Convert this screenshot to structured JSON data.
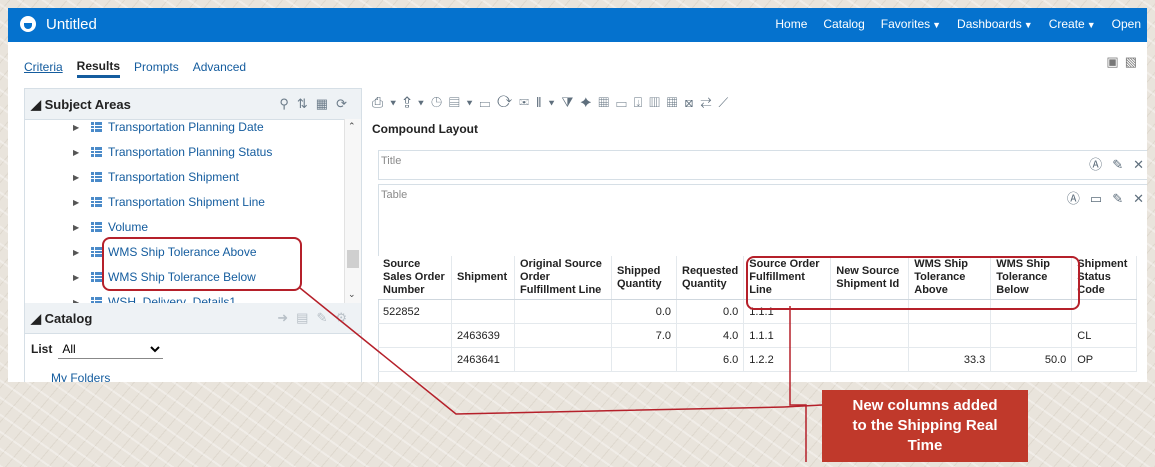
{
  "app": {
    "title": "Untitled"
  },
  "topnav": {
    "home": "Home",
    "catalog": "Catalog",
    "favorites": "Favorites",
    "dashboards": "Dashboards",
    "create": "Create",
    "open": "Open"
  },
  "subtabs": {
    "criteria": "Criteria",
    "results": "Results",
    "prompts": "Prompts",
    "advanced": "Advanced"
  },
  "subject_areas": {
    "title": "Subject Areas",
    "items": [
      "Transportation Planning Date",
      "Transportation Planning Status",
      "Transportation Shipment",
      "Transportation Shipment Line",
      "Volume",
      "WMS Ship Tolerance Above",
      "WMS Ship Tolerance Below",
      "WSH_Delivery_Details1"
    ]
  },
  "catalog": {
    "title": "Catalog",
    "list_label": "List",
    "list_value": "All",
    "folder": "My Folders"
  },
  "compound": {
    "title": "Compound Layout",
    "title_view": "Title",
    "table_view": "Table"
  },
  "table": {
    "headers": [
      "Source Sales Order Number",
      "Shipment",
      "Original Source Order Fulfillment Line",
      "Shipped Quantity",
      "Requested Quantity",
      "Source Order Fulfillment Line",
      "New Source Shipment Id",
      "WMS Ship Tolerance Above",
      "WMS Ship Tolerance Below",
      "Shipment Status Code"
    ],
    "rows": [
      [
        "522852",
        "",
        "",
        "0.0",
        "0.0",
        "1.1.1",
        "",
        "",
        "",
        ""
      ],
      [
        "",
        "2463639",
        "",
        "7.0",
        "4.0",
        "1.1.1",
        "",
        "",
        "",
        "CL"
      ],
      [
        "",
        "2463641",
        "",
        "",
        "6.0",
        "1.2.2",
        "",
        "33.3",
        "50.0",
        "OP"
      ]
    ]
  },
  "callout": {
    "line1": "New columns added",
    "line2": "to the Shipping Real",
    "line3": "Time"
  },
  "colors": {
    "topbar": "#0572ce",
    "highlight": "#b5202a",
    "callout": "#c0392b",
    "link": "#145c9e"
  },
  "icons": [
    "search-icon",
    "sort-icon",
    "refresh-icon",
    "print-icon",
    "export-icon",
    "save-icon"
  ]
}
